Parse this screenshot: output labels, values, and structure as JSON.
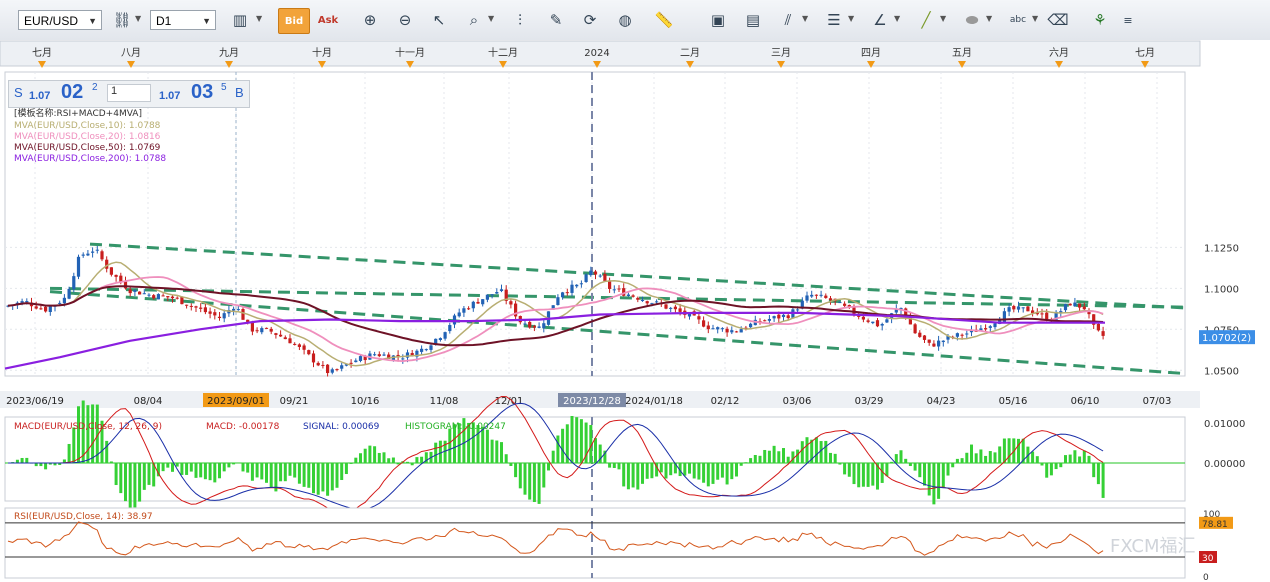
{
  "toolbar": {
    "symbol": "EUR/USD",
    "timeframe": "D1",
    "buttons": [
      "chain-icon",
      "bar-chart-icon",
      "bid-icon",
      "ask-icon",
      "zoom-in-icon",
      "zoom-out-icon",
      "cursor-icon",
      "zoom-area-icon",
      "fibonacci-icon",
      "edit-icon",
      "refresh-icon",
      "globe-icon",
      "ruler-icon",
      "image-icon",
      "chart-image-icon",
      "pitchfork-icon",
      "lines-icon",
      "angle-icon",
      "trend-line-icon",
      "ellipse-icon",
      "label-icon",
      "eraser-icon",
      "tree-icon",
      "menu-icon"
    ],
    "bid_label": "Bid",
    "ask_label": "Ask"
  },
  "quote": {
    "s_label": "S",
    "bid_prefix": "1.07",
    "bid_big": "02",
    "bid_sup": "2",
    "qty": "1",
    "ask_prefix": "1.07",
    "ask_big": "03",
    "ask_sup": "5",
    "b_label": "B"
  },
  "months": [
    "七月",
    "八月",
    "九月",
    "十月",
    "十一月",
    "十二月",
    "2024",
    "二月",
    "三月",
    "四月",
    "五月",
    "六月",
    "七月"
  ],
  "legend": {
    "template": "[模板名称:RSI+MACD+4MVA]",
    "mva10": "MVA(EUR/USD,Close,10): 1.0788",
    "mva20": "MVA(EUR/USD,Close,20): 1.0816",
    "mva50": "MVA(EUR/USD,Close,50): 1.0769",
    "mva200": "MVA(EUR/USD,Close,200): 1.0788"
  },
  "price_axis": [
    "1.1250",
    "1.1000",
    "1.0750",
    "1.0500"
  ],
  "current_price": "1.0702(2)",
  "date_axis": [
    "2023/06/19",
    "08/04",
    "2023/09/01",
    "09/21",
    "10/16",
    "11/08",
    "12/01",
    "2023/12/28",
    "2024/01/18",
    "02/12",
    "03/06",
    "03/29",
    "04/23",
    "05/16",
    "06/10",
    "07/03"
  ],
  "macd": {
    "label": "MACD(EUR/USD,Close, 12, 26, 9)",
    "macd_value": "MACD: -0.00178",
    "signal_value": "SIGNAL: 0.00069",
    "hist_value": "HISTOGRAM: -0.00247",
    "axis": [
      "0.01000",
      "0.00000"
    ]
  },
  "rsi": {
    "label": "RSI(EUR/USD,Close, 14): 38.97",
    "axis": [
      "100",
      "78.81",
      "30",
      "0"
    ]
  },
  "watermark": "FXCM福汇",
  "colors": {
    "bull": "#2262b5",
    "bear": "#c81e1e",
    "mva10": "#b8ae72",
    "mva20": "#ef8fbd",
    "mva50": "#6e1226",
    "mva200": "#8a1fe0",
    "channel": "#35956a",
    "macd": "#d41a1a",
    "signal": "#1a2fa8",
    "histogram": "#35d035",
    "rsi": "#d4581c",
    "marker": "#f29a16"
  }
}
